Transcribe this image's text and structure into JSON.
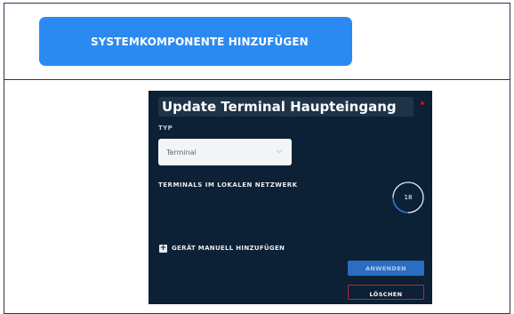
{
  "toolbar": {
    "add_component_label": "SYSTEMKOMPONENTE HINZUFÜGEN",
    "accent_color": "#2b8af1"
  },
  "panel": {
    "title": "Update Terminal Haupteingang",
    "status_color": "#e0001b",
    "background_color": "#0c2036",
    "type_label": "TYP",
    "type_selected": "Terminal",
    "network_label": "TERMINALS IM LOKALEN NETZWERK",
    "terminal_count": "18",
    "manual_add_label": "GERÄT MANUELL HINZUFÜGEN",
    "apply_label": "ANWENDEN",
    "delete_label": "LÖSCHEN",
    "icons": [
      "chevron-down-icon",
      "plus-icon"
    ]
  }
}
